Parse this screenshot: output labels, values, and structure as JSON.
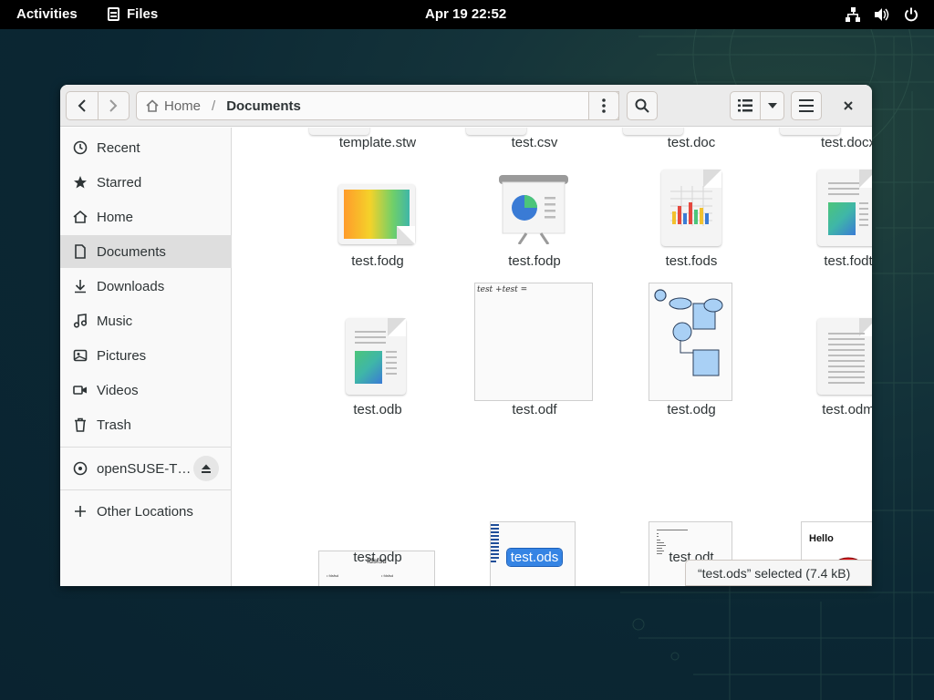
{
  "topbar": {
    "activities": "Activities",
    "app_name": "Files",
    "clock": "Apr 19  22:52"
  },
  "window": {
    "path": {
      "home": "Home",
      "current": "Documents"
    }
  },
  "sidebar": {
    "items": [
      {
        "label": "Recent",
        "icon": "clock-icon"
      },
      {
        "label": "Starred",
        "icon": "star-icon"
      },
      {
        "label": "Home",
        "icon": "home-icon"
      },
      {
        "label": "Documents",
        "icon": "document-icon"
      },
      {
        "label": "Downloads",
        "icon": "download-icon"
      },
      {
        "label": "Music",
        "icon": "music-icon"
      },
      {
        "label": "Pictures",
        "icon": "pictures-icon"
      },
      {
        "label": "Videos",
        "icon": "video-icon"
      },
      {
        "label": "Trash",
        "icon": "trash-icon"
      }
    ],
    "device": "openSUSE-T…",
    "other": "Other Locations"
  },
  "files": {
    "row0": [
      "template.stw",
      "test.csv",
      "test.doc",
      "test.docx"
    ],
    "row1": [
      "test.fodg",
      "test.fodp",
      "test.fods",
      "test.fodt"
    ],
    "row2": [
      "test.odb",
      "test.odf",
      "test.odg",
      "test.odm"
    ],
    "row3": [
      "test.odp",
      "test.ods",
      "test.odt"
    ],
    "odf_thumb_text": "test +test =",
    "odp_thumb_title": "fdsfsd",
    "odp_thumb_bullet1": "• fdsfsd",
    "odp_thumb_bullet2": "• fdsfsd",
    "hello_thumb_text": "Hello"
  },
  "status": "“test.ods” selected  (7.4 kB)",
  "colors": {
    "selection": "#3584e4",
    "topbar": "#000000",
    "window_header": "#ebebeb"
  }
}
